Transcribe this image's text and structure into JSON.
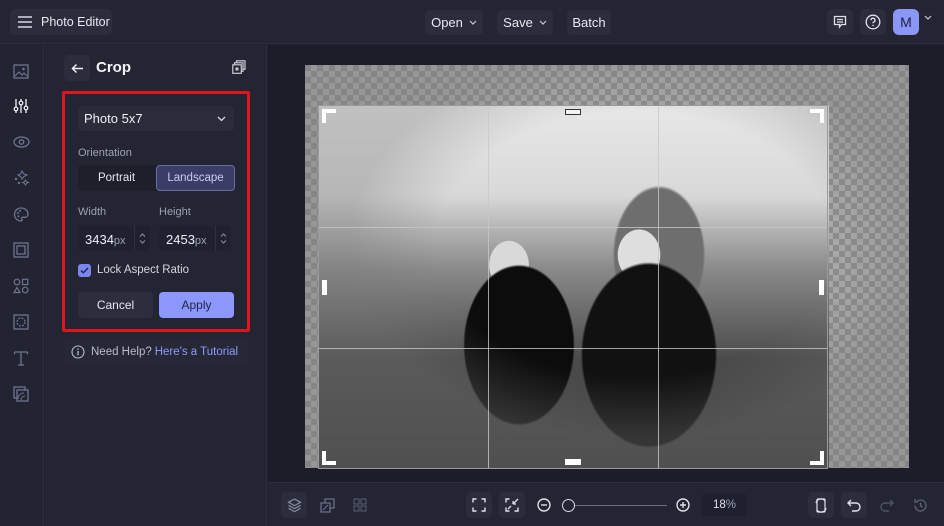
{
  "app": {
    "title": "Photo Editor",
    "menu": {
      "open": "Open",
      "save": "Save",
      "batch": "Batch"
    },
    "user_initial": "M",
    "icons": {
      "menu": "hamburger-icon",
      "feedback": "feedback-icon",
      "help": "help-icon"
    }
  },
  "rail": {
    "items": [
      {
        "name": "image",
        "icon": "image-icon",
        "active": false
      },
      {
        "name": "adjust",
        "icon": "sliders-icon",
        "active": true
      },
      {
        "name": "view",
        "icon": "eye-icon",
        "active": false
      },
      {
        "name": "effects",
        "icon": "sparkle-icon",
        "active": false
      },
      {
        "name": "artsy",
        "icon": "palette-icon",
        "active": false
      },
      {
        "name": "frames",
        "icon": "frame-icon",
        "active": false
      },
      {
        "name": "graphics",
        "icon": "shapes-icon",
        "active": false
      },
      {
        "name": "overlays",
        "icon": "overlay-icon",
        "active": false
      },
      {
        "name": "text",
        "icon": "text-icon",
        "active": false
      },
      {
        "name": "textures",
        "icon": "texture-icon",
        "active": false
      }
    ]
  },
  "panel": {
    "title": "Crop",
    "preset": "Photo 5x7",
    "orientation_label": "Orientation",
    "orientation_options": [
      "Portrait",
      "Landscape"
    ],
    "orientation_selected": "Landscape",
    "width_label": "Width",
    "height_label": "Height",
    "width_value": "3434",
    "height_value": "2453",
    "unit": "px",
    "lock_label": "Lock Aspect Ratio",
    "lock_checked": true,
    "cancel": "Cancel",
    "apply": "Apply",
    "help_text": "Need Help?",
    "help_link": "Here's a Tutorial"
  },
  "canvas": {
    "image_desc": "Black-and-white photo of two laughing women",
    "crop_grid": "rule-of-thirds"
  },
  "bottombar": {
    "zoom_value": "18",
    "zoom_unit": "%",
    "zoom_level_fraction": 0.0,
    "tools": [
      "layers-icon",
      "duplicate-icon",
      "grid-icon",
      "fit-screen-icon",
      "actual-size-icon",
      "zoom-out-icon",
      "zoom-in-icon",
      "reset-icon",
      "undo-icon",
      "redo-icon",
      "history-icon"
    ]
  },
  "colors": {
    "accent": "#8b97fb",
    "highlight_box": "#e0141c",
    "background": "#1f2130"
  }
}
